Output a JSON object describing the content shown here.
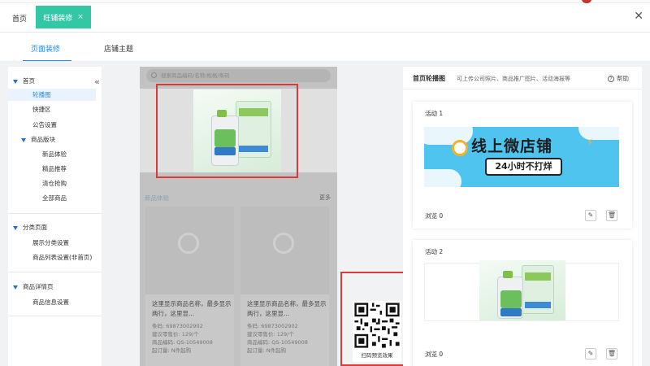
{
  "topbar": {
    "home_label": "首页",
    "active_tab_label": "旺铺装修",
    "active_tab_close": "×",
    "window_close": "✕"
  },
  "subtabs": {
    "page_decor": "页面装修",
    "shop_theme": "店铺主题"
  },
  "sidebar": {
    "collapse": "«",
    "home": "首页",
    "carousel": "轮播图",
    "quick_area": "快捷区",
    "notice_settings": "公告设置",
    "product_section": "商品版块",
    "new_trial": "新品体验",
    "featured": "精品推荐",
    "clearance": "清仓抢购",
    "all_products": "全部商品",
    "category_page": "分类页面",
    "show_category_settings": "展示分类设置",
    "product_list_settings": "商品列表设置(非首页)",
    "product_detail_page": "商品详情页",
    "product_info_settings": "商品信息设置"
  },
  "phone": {
    "search_placeholder": "搜索商品编码/名称/规格/条码",
    "section_title": "新品体验",
    "more": "更多",
    "cards": [
      {
        "name": "这里显示商品名称，最多显示两行，这里显...",
        "barcode": "条码: 69873002902",
        "price": "建议零售价: 129/个",
        "code": "商品编码: QS-10549008",
        "moq": "起订量: N件起购"
      },
      {
        "name": "这里显示商品名称，最多显示两行，这里显...",
        "barcode": "条码: 69873002902",
        "price": "建议零售价: 129/个",
        "code": "商品编码: QS-10549008",
        "moq": "起订量: N件起购"
      }
    ]
  },
  "qr": {
    "caption": "扫码预览效果"
  },
  "right_panel": {
    "title": "首页轮播图",
    "subtitle": "可上传公司照片、商品推广图片、活动海报等",
    "help": "帮助",
    "activities": [
      {
        "label": "活动 1",
        "views": "浏览 0",
        "banner_headline": "线上微店铺",
        "banner_pill": "24小时不打烊"
      },
      {
        "label": "活动 2",
        "views": "浏览 0"
      }
    ]
  },
  "colors": {
    "accent_green": "#32c8a6",
    "accent_blue": "#2a8ad6",
    "highlight_red": "#d93a3a"
  }
}
